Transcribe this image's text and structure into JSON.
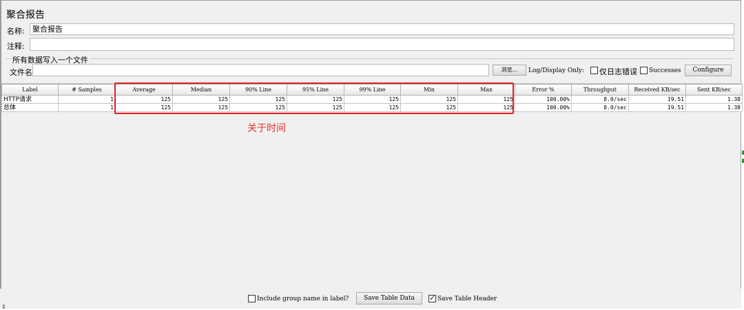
{
  "panel": {
    "title": "聚合报告"
  },
  "name_field": {
    "label": "名称:",
    "value": "聚合报告"
  },
  "comment_field": {
    "label": "注释:",
    "value": ""
  },
  "file_group": {
    "title": "所有数据写入一个文件",
    "filename_label": "文件名",
    "filename_value": "",
    "browse_label": "浏览...",
    "log_display_label": "Log/Display Only:",
    "errors_only_label": "仅日志错误",
    "errors_only_checked": false,
    "successes_label": "Successes",
    "successes_checked": false,
    "configure_label": "Configure"
  },
  "table": {
    "columns": [
      "Label",
      "# Samples",
      "Average",
      "Median",
      "90% Line",
      "95% Line",
      "99% Line",
      "Min",
      "Max",
      "Error %",
      "Throughput",
      "Received KB/sec",
      "Sent KB/sec"
    ],
    "rows": [
      [
        "HTTP请求",
        "1",
        "125",
        "125",
        "125",
        "125",
        "125",
        "125",
        "125",
        "100.00%",
        "8.0/sec",
        "19.51",
        "1.38"
      ],
      [
        "总体",
        "1",
        "125",
        "125",
        "125",
        "125",
        "125",
        "125",
        "125",
        "100.00%",
        "8.0/sec",
        "19.51",
        "1.38"
      ]
    ]
  },
  "annotation": {
    "text": "关于时间",
    "color": "#e8302a"
  },
  "footer": {
    "include_group_label": "Include group name in label?",
    "include_group_checked": false,
    "save_table_data_label": "Save Table Data",
    "save_table_header_label": "Save Table Header",
    "save_table_header_checked": true
  }
}
